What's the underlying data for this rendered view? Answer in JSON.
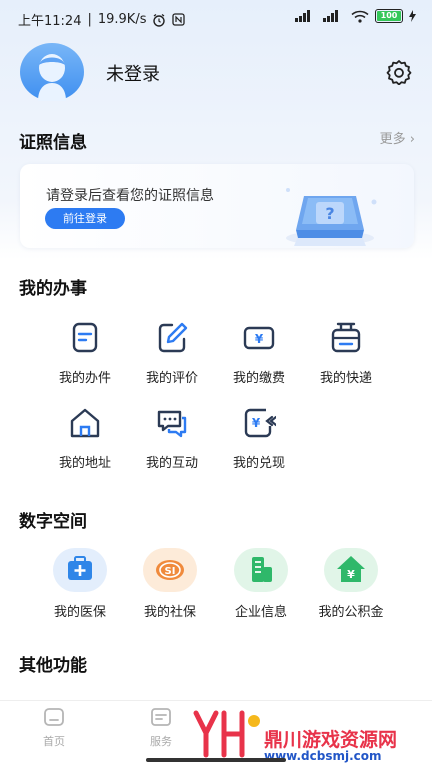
{
  "status_bar": {
    "time": "上午11:24",
    "network_speed": "19.9K/s",
    "battery": "100"
  },
  "profile": {
    "user_name": "未登录"
  },
  "cert_section": {
    "title": "证照信息",
    "more": "更多 ›",
    "card_text": "请登录后查看您的证照信息",
    "login_button": "前往登录"
  },
  "affairs_section": {
    "title": "我的办事",
    "items": [
      {
        "label": "我的办件",
        "icon": "document-icon"
      },
      {
        "label": "我的评价",
        "icon": "edit-icon"
      },
      {
        "label": "我的缴费",
        "icon": "payment-icon"
      },
      {
        "label": "我的快递",
        "icon": "express-icon"
      },
      {
        "label": "我的地址",
        "icon": "home-icon"
      },
      {
        "label": "我的互动",
        "icon": "chat-icon"
      },
      {
        "label": "我的兑现",
        "icon": "redeem-icon"
      }
    ]
  },
  "digital_section": {
    "title": "数字空间",
    "items": [
      {
        "label": "我的医保",
        "icon": "medical-kit-icon",
        "color": "#2f86e8"
      },
      {
        "label": "我的社保",
        "icon": "social-security-icon",
        "color": "#f08a3c"
      },
      {
        "label": "企业信息",
        "icon": "building-icon",
        "color": "#2fb86a"
      },
      {
        "label": "我的公积金",
        "icon": "housing-fund-icon",
        "color": "#2fb86a"
      }
    ]
  },
  "other_section": {
    "title": "其他功能"
  },
  "tabbar": {
    "tabs": [
      {
        "label": "首页",
        "icon": "home-tab-icon"
      },
      {
        "label": "服务",
        "icon": "service-tab-icon"
      }
    ]
  },
  "watermark": {
    "line1": "鼎川游戏资源网",
    "line2": "www.dcbsmj.com"
  },
  "colors": {
    "accent": "#2d7bf2",
    "icon_stroke": "#2b3a55"
  }
}
